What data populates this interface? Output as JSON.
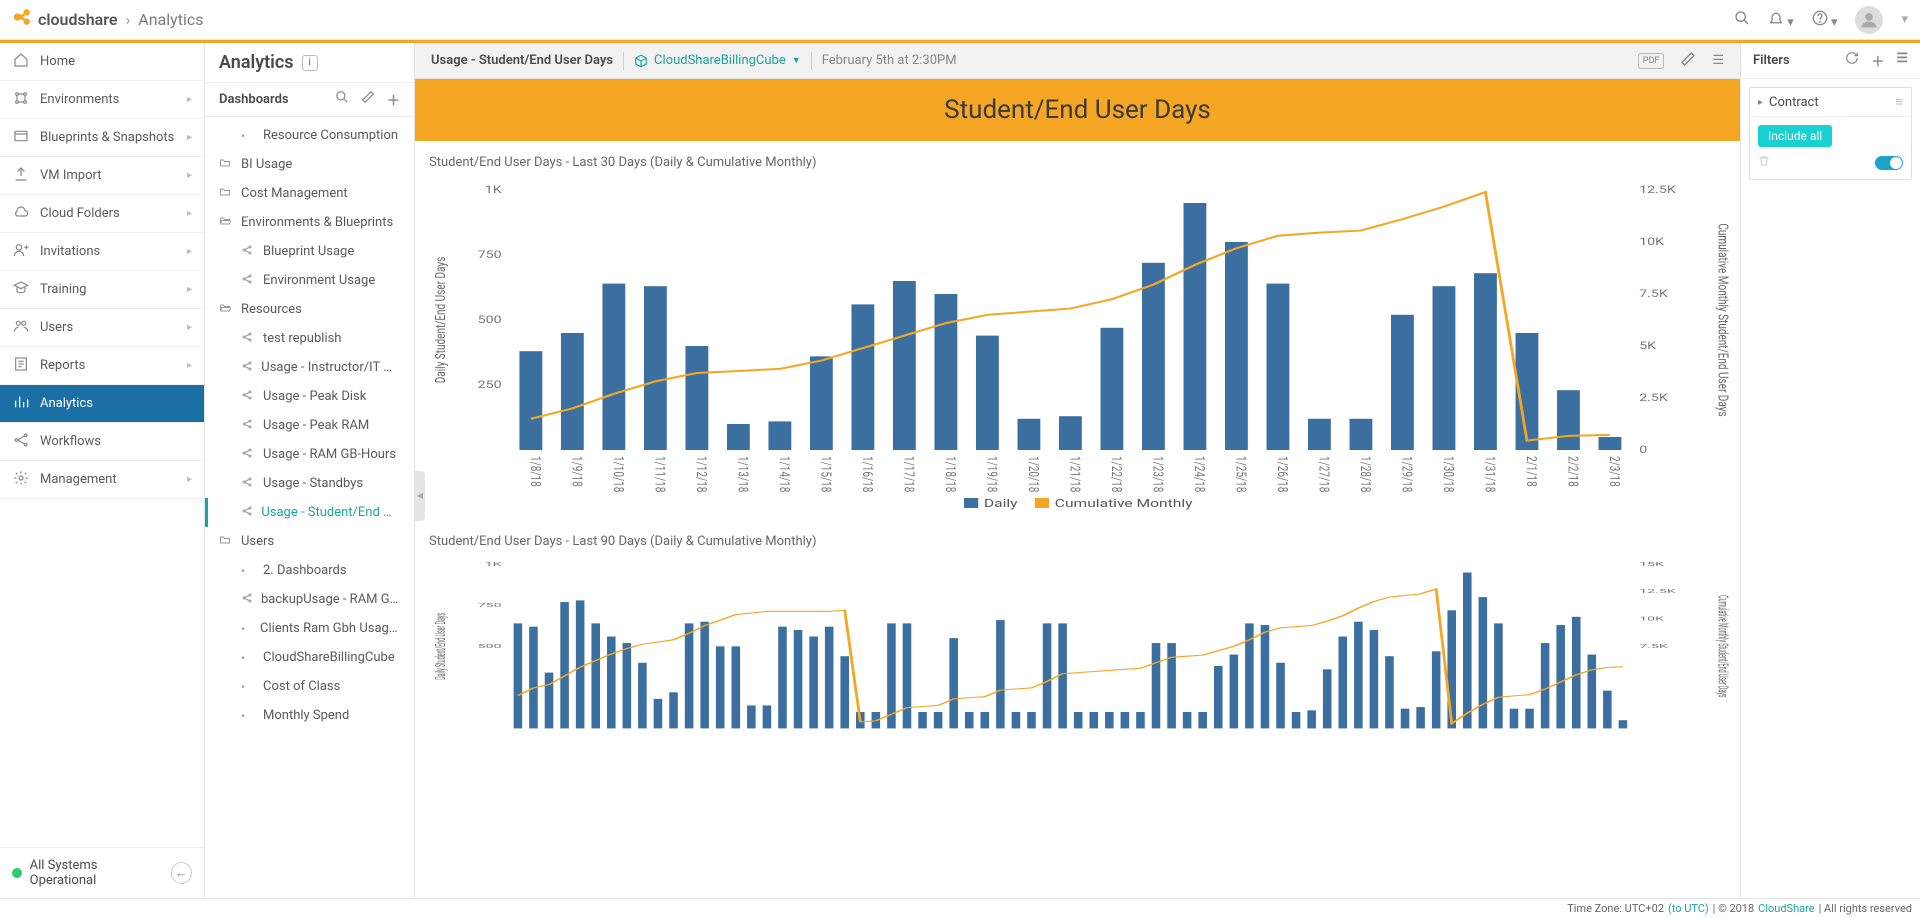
{
  "header": {
    "brand": "cloudshare",
    "breadcrumb": "Analytics"
  },
  "nav": {
    "items": [
      {
        "icon": "home",
        "label": "Home",
        "expandable": false
      },
      {
        "icon": "env",
        "label": "Environments",
        "expandable": true
      },
      {
        "icon": "blueprint",
        "label": "Blueprints & Snapshots",
        "expandable": true
      },
      {
        "icon": "upload",
        "label": "VM Import",
        "expandable": true
      },
      {
        "icon": "cloud",
        "label": "Cloud Folders",
        "expandable": true
      },
      {
        "icon": "invite",
        "label": "Invitations",
        "expandable": true
      },
      {
        "icon": "training",
        "label": "Training",
        "expandable": true
      },
      {
        "icon": "users",
        "label": "Users",
        "expandable": true
      },
      {
        "icon": "reports",
        "label": "Reports",
        "expandable": true
      },
      {
        "icon": "analytics",
        "label": "Analytics",
        "expandable": false,
        "active": true
      },
      {
        "icon": "workflow",
        "label": "Workflows",
        "expandable": false
      },
      {
        "icon": "gear",
        "label": "Management",
        "expandable": true
      }
    ],
    "status": "All Systems Operational"
  },
  "dashboards": {
    "section_title": "Analytics",
    "panel_title": "Dashboards",
    "tree": [
      {
        "type": "leaf",
        "icon": "dot",
        "label": "Resource Consumption"
      },
      {
        "type": "folder",
        "icon": "folder",
        "label": "BI Usage"
      },
      {
        "type": "folder",
        "icon": "folder",
        "label": "Cost Management"
      },
      {
        "type": "folder-open",
        "icon": "folder-open",
        "label": "Environments & Blueprints"
      },
      {
        "type": "leaf",
        "icon": "share",
        "label": "Blueprint Usage"
      },
      {
        "type": "leaf",
        "icon": "share",
        "label": "Environment Usage"
      },
      {
        "type": "folder-open",
        "icon": "folder-open",
        "label": "Resources"
      },
      {
        "type": "leaf",
        "icon": "share",
        "label": "test republish"
      },
      {
        "type": "leaf",
        "icon": "share",
        "label": "Usage - Instructor/IT User..."
      },
      {
        "type": "leaf",
        "icon": "share",
        "label": "Usage - Peak Disk"
      },
      {
        "type": "leaf",
        "icon": "share",
        "label": "Usage - Peak RAM"
      },
      {
        "type": "leaf",
        "icon": "share",
        "label": "Usage - RAM GB-Hours"
      },
      {
        "type": "leaf",
        "icon": "share",
        "label": "Usage - Standbys"
      },
      {
        "type": "leaf",
        "icon": "share",
        "label": "Usage - Student/End User...",
        "active": true
      },
      {
        "type": "folder",
        "icon": "folder",
        "label": "Users"
      },
      {
        "type": "leaf",
        "icon": "dot",
        "label": "2. Dashboards"
      },
      {
        "type": "leaf",
        "icon": "share",
        "label": "backupUsage - RAM GB-Hours"
      },
      {
        "type": "leaf",
        "icon": "dot",
        "label": "Clients Ram Gbh Usage Report"
      },
      {
        "type": "leaf",
        "icon": "dot",
        "label": "CloudShareBillingCube"
      },
      {
        "type": "leaf",
        "icon": "dot",
        "label": "Cost of Class"
      },
      {
        "type": "leaf",
        "icon": "dot",
        "label": "Monthly Spend"
      }
    ]
  },
  "toolbar": {
    "title": "Usage - Student/End User Days",
    "cube": "CloudShareBillingCube",
    "date": "February 5th at 2:30PM",
    "pdf": "PDF"
  },
  "banner": "Student/End User Days",
  "chart1_title": "Student/End User Days - Last 30 Days (Daily & Cumulative Monthly)",
  "chart2_title": "Student/End User Days - Last 90 Days (Daily & Cumulative Monthly)",
  "legend": {
    "daily": "Daily",
    "cumulative": "Cumulative Monthly"
  },
  "yaxis_left": "Daily Student/End User Days",
  "yaxis_right": "Cumulative Monthly Student/End User Days",
  "filters": {
    "title": "Filters",
    "contract": "Contract",
    "include_all": "Include all"
  },
  "footer": {
    "tz_label": "Time Zone: UTC+02 ",
    "tz_link": "(to UTC)",
    "copyright": " | © 2018 ",
    "brand": "CloudShare",
    "rights": " | All rights reserved"
  },
  "chart_data": [
    {
      "type": "bar+line",
      "title": "Student/End User Days - Last 30 Days (Daily & Cumulative Monthly)",
      "categories": [
        "1/8/18",
        "1/9/18",
        "1/10/18",
        "1/11/18",
        "1/12/18",
        "1/13/18",
        "1/14/18",
        "1/15/18",
        "1/16/18",
        "1/17/18",
        "1/18/18",
        "1/19/18",
        "1/20/18",
        "1/21/18",
        "1/22/18",
        "1/23/18",
        "1/24/18",
        "1/25/18",
        "1/26/18",
        "1/27/18",
        "1/28/18",
        "1/29/18",
        "1/30/18",
        "1/31/18",
        "2/1/18",
        "2/2/18",
        "2/3/18"
      ],
      "series": [
        {
          "name": "Daily",
          "axis": "left",
          "type": "bar",
          "values": [
            380,
            450,
            640,
            630,
            400,
            100,
            110,
            360,
            560,
            650,
            600,
            440,
            120,
            130,
            470,
            720,
            950,
            800,
            640,
            120,
            120,
            520,
            630,
            680,
            450,
            230,
            50
          ]
        },
        {
          "name": "Cumulative Monthly",
          "axis": "right",
          "type": "line",
          "values": [
            1500,
            2000,
            2700,
            3300,
            3700,
            3800,
            3900,
            4300,
            4900,
            5500,
            6100,
            6500,
            6650,
            6800,
            7250,
            7950,
            8900,
            9700,
            10300,
            10450,
            10550,
            11100,
            11700,
            12400,
            450,
            680,
            730
          ]
        }
      ],
      "y_left": {
        "label": "Daily Student/End User Days",
        "ticks": [
          250,
          500,
          750,
          "1K"
        ],
        "range": [
          0,
          1000
        ]
      },
      "y_right": {
        "label": "Cumulative Monthly Student/End User Days",
        "ticks": [
          0,
          "2.5K",
          "5K",
          "7.5K",
          "10K",
          "12.5K"
        ],
        "range": [
          0,
          12500
        ]
      },
      "colors": {
        "bar": "#3b6fa0",
        "line": "#f5a623"
      }
    },
    {
      "type": "bar+line",
      "title": "Student/End User Days - Last 90 Days (Daily & Cumulative Monthly)",
      "y_left": {
        "label": "Daily Student/End User Days",
        "ticks": [
          500,
          750,
          "1K"
        ],
        "range": [
          0,
          1000
        ]
      },
      "y_right": {
        "label": "Cumulative Monthly Student/End User Days",
        "ticks": [
          "7.5K",
          "10K",
          "12.5K",
          "15K"
        ],
        "range": [
          0,
          15000
        ]
      },
      "categories_sample": "90 daily dates (partial render)",
      "series": [
        {
          "name": "Daily",
          "axis": "left",
          "type": "bar",
          "values": [
            640,
            620,
            340,
            770,
            780,
            640,
            560,
            520,
            400,
            180,
            220,
            640,
            650,
            500,
            500,
            140,
            140,
            620,
            600,
            560,
            620,
            440,
            100,
            100,
            640,
            640,
            100,
            100,
            550,
            100,
            100,
            660,
            100,
            100,
            640,
            640,
            100,
            100,
            100,
            100,
            100,
            520,
            520,
            100,
            100,
            380,
            450,
            640,
            630,
            400,
            100,
            110,
            360,
            560,
            650,
            600,
            440,
            120,
            130,
            470,
            720,
            950,
            800,
            640,
            120,
            120,
            520,
            630,
            680,
            450,
            230,
            50
          ]
        },
        {
          "name": "Cumulative Monthly",
          "axis": "right",
          "type": "line",
          "values": [
            3000,
            3700,
            4000,
            4800,
            5600,
            6200,
            6800,
            7300,
            7700,
            7900,
            8100,
            8700,
            9400,
            9900,
            10400,
            10550,
            10700,
            10700,
            10700,
            10700,
            10700,
            10800,
            600,
            700,
            1300,
            1900,
            2000,
            2100,
            2700,
            2800,
            2900,
            3500,
            3600,
            3700,
            4300,
            5000,
            5100,
            5200,
            5300,
            5400,
            5500,
            6000,
            6500,
            6600,
            6700,
            7100,
            7500,
            8100,
            8800,
            9200,
            9300,
            9400,
            9800,
            10300,
            11000,
            11600,
            12000,
            12150,
            12300,
            12750,
            450,
            1400,
            2200,
            2850,
            2970,
            3090,
            3600,
            4250,
            4900,
            5350,
            5580,
            5630
          ]
        }
      ],
      "colors": {
        "bar": "#3b6fa0",
        "line": "#f5a623"
      }
    }
  ]
}
